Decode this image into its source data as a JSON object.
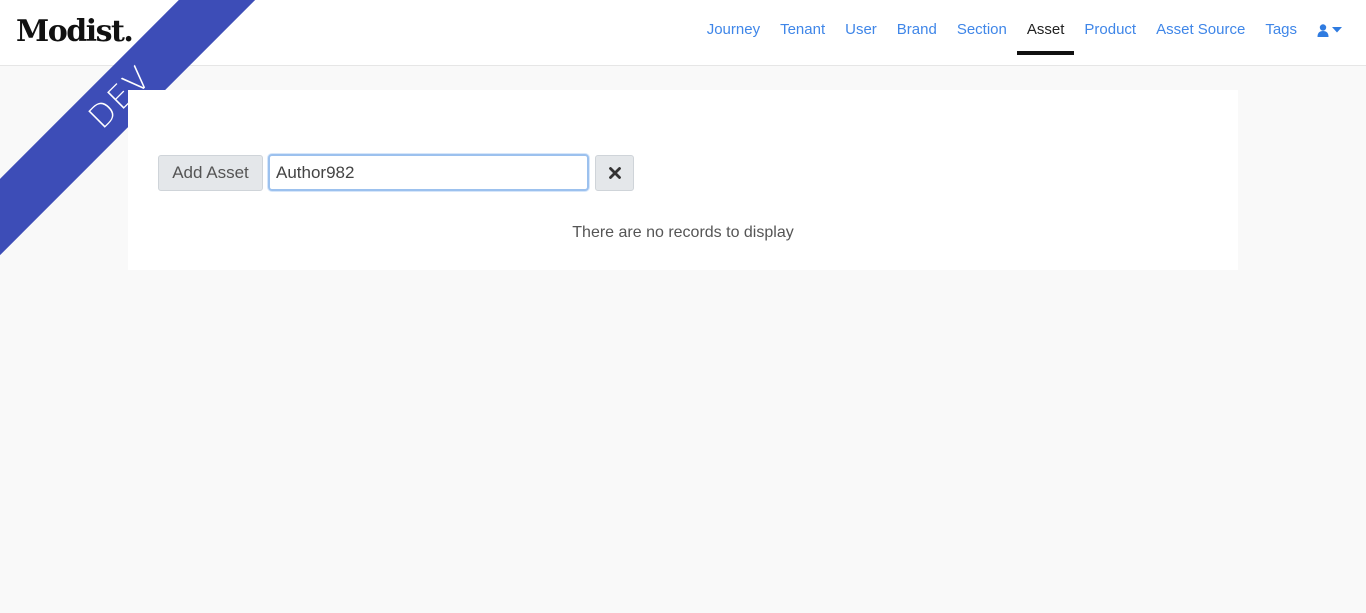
{
  "brand": {
    "logo_text": "Modist."
  },
  "ribbon": {
    "label": "DEV",
    "color": "#3d4db7"
  },
  "nav": {
    "items": [
      {
        "label": "Journey",
        "active": false
      },
      {
        "label": "Tenant",
        "active": false
      },
      {
        "label": "User",
        "active": false
      },
      {
        "label": "Brand",
        "active": false
      },
      {
        "label": "Section",
        "active": false
      },
      {
        "label": "Asset",
        "active": true
      },
      {
        "label": "Product",
        "active": false
      },
      {
        "label": "Asset Source",
        "active": false
      },
      {
        "label": "Tags",
        "active": false
      }
    ],
    "user_icon": "user-icon",
    "link_color": "#3f86e8"
  },
  "toolbar": {
    "add_label": "Add Asset",
    "search_value": "Author982",
    "clear_icon": "close-icon"
  },
  "table": {
    "empty_message": "There are no records to display"
  }
}
